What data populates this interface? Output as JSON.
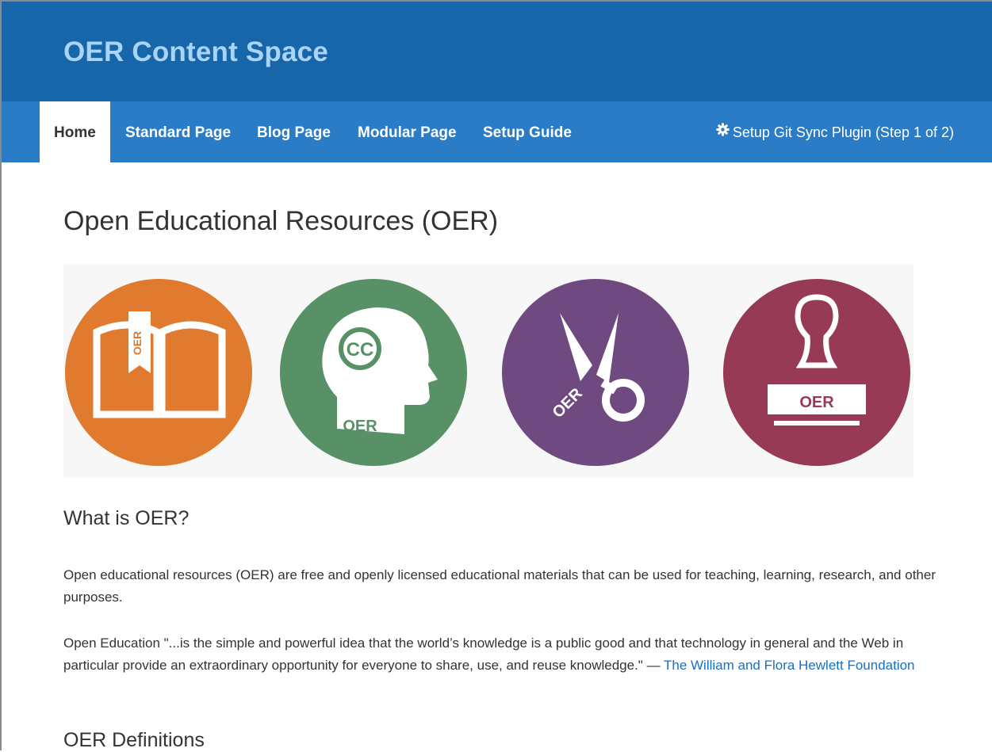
{
  "header": {
    "site_title": "OER Content Space"
  },
  "nav": {
    "items": [
      {
        "label": "Home",
        "active": true
      },
      {
        "label": "Standard Page"
      },
      {
        "label": "Blog Page"
      },
      {
        "label": "Modular Page"
      },
      {
        "label": "Setup Guide"
      }
    ],
    "right_link": "Setup Git Sync Plugin (Step 1 of 2)",
    "right_icon": "gear-icon"
  },
  "main": {
    "title": "Open Educational Resources (OER)",
    "banner": {
      "icons": [
        {
          "name": "book-icon",
          "color": "#e07a2e",
          "label": "OER"
        },
        {
          "name": "cc-head-icon",
          "color": "#579165",
          "label": "OER",
          "cc": "CC"
        },
        {
          "name": "scissors-icon",
          "color": "#6e4a80",
          "label": "OER"
        },
        {
          "name": "stamp-icon",
          "color": "#963a55",
          "label": "OER"
        }
      ]
    },
    "what_heading": "What is OER?",
    "para1": "Open educational resources (OER) are free and openly licensed educational materials that can be used for teaching, learning, research, and other purposes.",
    "para2_text": "Open Education \"...is the simple and powerful idea that the world’s knowledge is a public good and that technology in general and the Web in particular provide an extraordinary opportunity for everyone to share, use, and reuse knowledge.\" — ",
    "para2_link": "The William and Flora Hewlett Foundation",
    "definitions_heading": "OER Definitions"
  },
  "colors": {
    "header_bg": "#1766a9",
    "nav_bg": "#2a7cc7",
    "title": "#a9d4f5",
    "link": "#1a6fbf"
  }
}
